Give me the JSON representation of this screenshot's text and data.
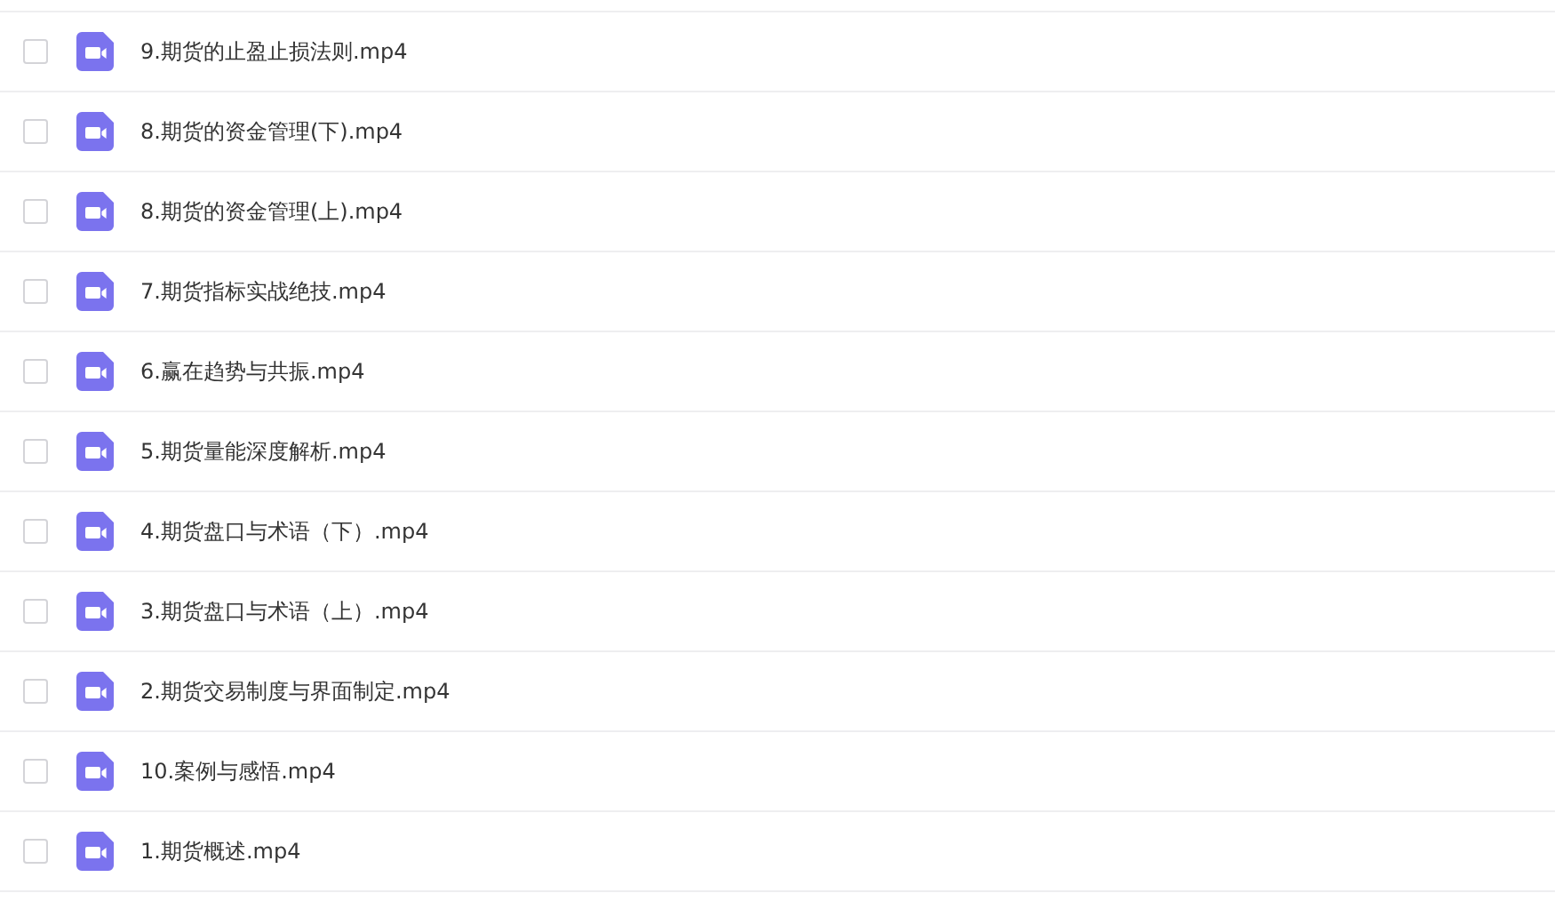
{
  "files": [
    {
      "name": "9.期货的止盈止损法则.mp4",
      "checked": false
    },
    {
      "name": "8.期货的资金管理(下).mp4",
      "checked": false
    },
    {
      "name": "8.期货的资金管理(上).mp4",
      "checked": false
    },
    {
      "name": "7.期货指标实战绝技.mp4",
      "checked": false
    },
    {
      "name": "6.赢在趋势与共振.mp4",
      "checked": false
    },
    {
      "name": "5.期货量能深度解析.mp4",
      "checked": false
    },
    {
      "name": "4.期货盘口与术语（下）.mp4",
      "checked": false
    },
    {
      "name": "3.期货盘口与术语（上）.mp4",
      "checked": false
    },
    {
      "name": "2.期货交易制度与界面制定.mp4",
      "checked": false
    },
    {
      "name": "10.案例与感悟.mp4",
      "checked": false
    },
    {
      "name": "1.期货概述.mp4",
      "checked": false
    }
  ]
}
